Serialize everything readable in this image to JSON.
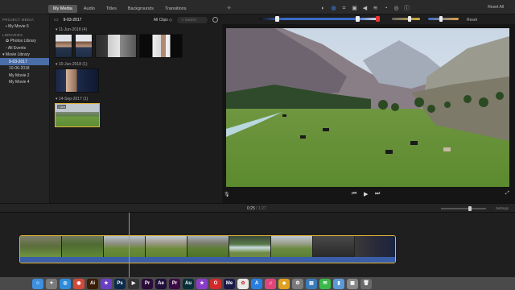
{
  "toolbar": {
    "tabs": [
      {
        "label": "My Media",
        "active": true
      },
      {
        "label": "Audio",
        "active": false
      },
      {
        "label": "Titles",
        "active": false
      },
      {
        "label": "Backgrounds",
        "active": false
      },
      {
        "label": "Transitions",
        "active": false
      }
    ],
    "reset_all_label": "Reset All",
    "adjust_icons": [
      "magic-wand-icon",
      "color-balance-icon",
      "color-correction-icon",
      "crop-icon",
      "stabilization-icon",
      "volume-icon",
      "noise-reduction-icon",
      "speed-icon",
      "filter-icon",
      "info-icon"
    ]
  },
  "color_correction": {
    "reset_label": "Reset"
  },
  "sidebar": {
    "project_media_header": "PROJECT MEDIA",
    "project_item": "My Movie 6",
    "libraries_header": "LIBRARIES",
    "items": [
      {
        "label": "Photos Library",
        "selected": false,
        "indent": false
      },
      {
        "label": "All Events",
        "selected": false,
        "indent": false
      },
      {
        "label": "Movie Library",
        "selected": false,
        "indent": false
      },
      {
        "label": "9-03-2017",
        "selected": true,
        "indent": true
      },
      {
        "label": "10-06-2018",
        "selected": false,
        "indent": true
      },
      {
        "label": "My Movie 2",
        "selected": false,
        "indent": true
      },
      {
        "label": "My Movie 4",
        "selected": false,
        "indent": true
      }
    ]
  },
  "browser": {
    "title": "9-03-2017",
    "filter": "All Clips",
    "search_placeholder": "Search",
    "sections": [
      {
        "header": "11-Jun-2018",
        "count": "(4)"
      },
      {
        "header": "10-Jun-2018",
        "count": "(1)"
      },
      {
        "header": "14-Sep-2017",
        "count": "(1)"
      }
    ],
    "clip_badge": "7.6m"
  },
  "timeline": {
    "current_time": "0:25",
    "separator": " / ",
    "total_time": "1:27",
    "settings_label": "Settings"
  },
  "dock": {
    "apps": [
      {
        "name": "finder-icon",
        "glyph": "☺",
        "color": "#3d8fe0"
      },
      {
        "name": "launchpad-icon",
        "glyph": "✦",
        "color": "#7a7a7a"
      },
      {
        "name": "safari-icon",
        "glyph": "◎",
        "color": "#2f8ad9"
      },
      {
        "name": "chrome-icon",
        "glyph": "◉",
        "color": "#d24a3a"
      },
      {
        "name": "illustrator-icon",
        "glyph": "Ai",
        "color": "#3a1d05"
      },
      {
        "name": "imovie-icon",
        "glyph": "★",
        "color": "#6b3fc4"
      },
      {
        "name": "photoshop-icon",
        "glyph": "Ps",
        "color": "#0c2a4a"
      },
      {
        "name": "final-cut-icon",
        "glyph": "▶",
        "color": "#333333"
      },
      {
        "name": "premiere-icon",
        "glyph": "Pr",
        "color": "#2a0b3a"
      },
      {
        "name": "after-effects-icon",
        "glyph": "Ae",
        "color": "#1f0f3a"
      },
      {
        "name": "premiere-rush-icon",
        "glyph": "Pr",
        "color": "#3a0b44"
      },
      {
        "name": "audition-icon",
        "glyph": "Au",
        "color": "#05303a"
      },
      {
        "name": "star-app-icon",
        "glyph": "★",
        "color": "#8a3cc8"
      },
      {
        "name": "opera-icon",
        "glyph": "O",
        "color": "#d22a2a"
      },
      {
        "name": "media-encoder-icon",
        "glyph": "Me",
        "color": "#1a1a4a"
      },
      {
        "name": "photos-icon",
        "glyph": "✿",
        "color": "#e8e8e8"
      },
      {
        "name": "app-store-icon",
        "glyph": "A",
        "color": "#2a7ee0"
      },
      {
        "name": "itunes-icon",
        "glyph": "♫",
        "color": "#e0457a"
      },
      {
        "name": "sketch-icon",
        "glyph": "◆",
        "color": "#e0a020"
      },
      {
        "name": "system-prefs-icon",
        "glyph": "⚙",
        "color": "#7a7a7a"
      },
      {
        "name": "preview-icon",
        "glyph": "▤",
        "color": "#3a7ab8"
      },
      {
        "name": "messages-icon",
        "glyph": "✉",
        "color": "#3ab84a"
      },
      {
        "name": "folder-icon",
        "glyph": "▮",
        "color": "#5a9ad8"
      },
      {
        "name": "photo-icon",
        "glyph": "▦",
        "color": "#888888"
      },
      {
        "name": "trash-icon",
        "glyph": "🗑",
        "color": "#6a6a6a"
      }
    ]
  }
}
